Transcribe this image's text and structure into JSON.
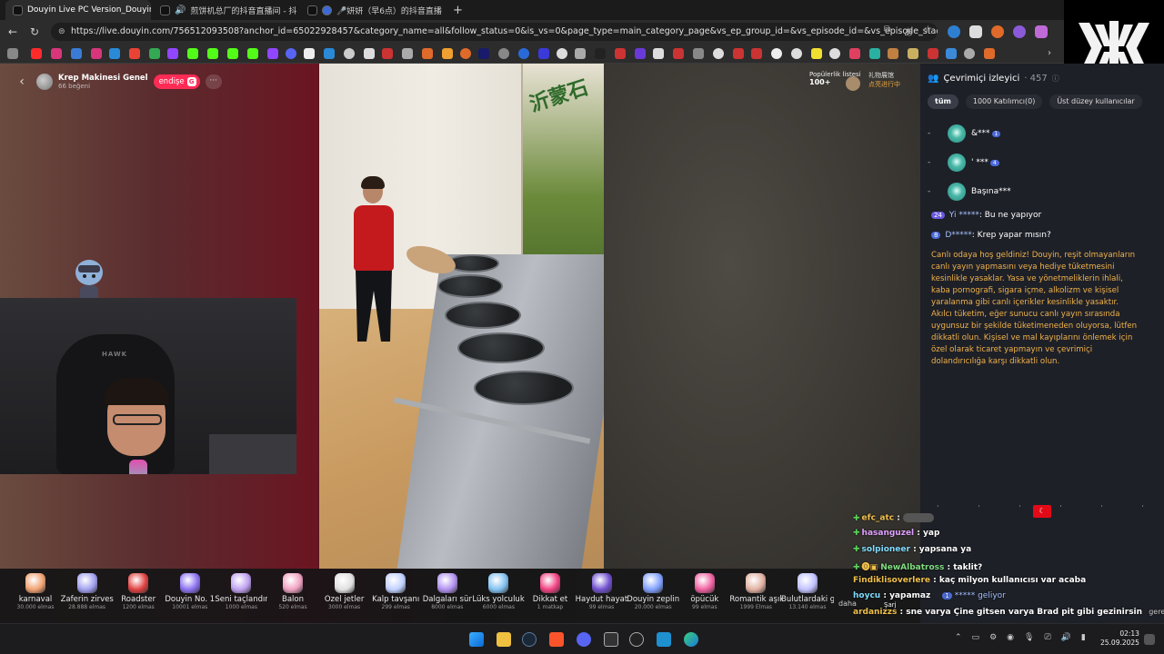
{
  "browser": {
    "tabs": [
      {
        "title": "Douyin Live PC Version_Douyin Li",
        "active": true
      },
      {
        "title": "煎饼机总厂的抖音直播间 - 抖",
        "active": false
      },
      {
        "title": "🎤妍妍（早6点）的抖音直播",
        "active": false
      }
    ],
    "url": "https://live.douyin.com/756512093508?anchor_id=65022928457&category_name=all&follow_status=0&is_vs=0&page_type=main_category_page&vs_ep_group_id=&vs_episode_id=&vs_episode_stage=&vs_season..."
  },
  "stream": {
    "room_name": "Krep Makinesi Genel",
    "likes": "66 beğeni",
    "follow_label": "endişe",
    "follow_badge": "G",
    "more_label": "···",
    "popular_label": "Popülerlik listesi",
    "popular_count": "100+",
    "gift_list_label": "礼物展馆",
    "gift_list_sub": "点亮进行中",
    "poster_text": "沂蒙石",
    "chair_brand": "HAWK"
  },
  "gifts": [
    {
      "name": "karnaval",
      "price": "30.000 elmas",
      "color": "#f0a070"
    },
    {
      "name": "Zaferin zirvesi",
      "price": "28.888 elmas",
      "color": "#a0a0f0"
    },
    {
      "name": "Roadster",
      "price": "1200 elmas",
      "color": "#e04040"
    },
    {
      "name": "Douyin No. 1",
      "price": "10001 elmas",
      "color": "#8a70f0"
    },
    {
      "name": "Seni taçlandır",
      "price": "1000 elmas",
      "color": "#c0a0f0"
    },
    {
      "name": "Balon",
      "price": "520 elmas",
      "color": "#f0a0c0"
    },
    {
      "name": "Özel jetler",
      "price": "3000 elmas",
      "color": "#e0e0e0"
    },
    {
      "name": "Kalp tavşanı",
      "price": "299 elmas",
      "color": "#c0d0ff"
    },
    {
      "name": "Dalgaları sür",
      "price": "8000 elmas",
      "color": "#b090f0"
    },
    {
      "name": "Lüks yolculukla",
      "price": "6000 elmas",
      "color": "#80c0f0"
    },
    {
      "name": "Dikkat et",
      "price": "1 matkap",
      "color": "#f04080"
    },
    {
      "name": "Haydut hayatı",
      "price": "99 elmas",
      "color": "#7050d0"
    },
    {
      "name": "Douyin zeplin",
      "price": "20.000 elmas",
      "color": "#80a0ff"
    },
    {
      "name": "öpücük",
      "price": "99 elmas",
      "color": "#f060a0"
    },
    {
      "name": "Romantik aşıklar",
      "price": "1999 Elmas",
      "color": "#e0b0a0"
    },
    {
      "name": "Bulutlardaki gi",
      "price": "13.140 elmas",
      "color": "#c0c0ff"
    }
  ],
  "gift_more": "daha",
  "chat": {
    "viewers_title": "Çevrimiçi izleyici",
    "viewers_count": "· 457",
    "filters": [
      "tüm",
      "1000 Katılımcı(0)",
      "Üst düzey kullanıcılar"
    ],
    "viewers": [
      {
        "name": "&***",
        "badge": "1"
      },
      {
        "name": "' ***",
        "badge": "4"
      },
      {
        "name": "Başına***",
        "badge": ""
      }
    ],
    "messages": [
      {
        "level": "24",
        "user": "Yi *****",
        "text": ": Bu ne yapıyor"
      },
      {
        "level": "8",
        "user": "D*****",
        "text": ": Krep yapar mısın?"
      }
    ],
    "notice": "Canlı odaya hoş geldiniz! Douyin, reşit olmayanların canlı yayın yapmasını veya hediye tüketmesini kesinlikle yasaklar. Yasa ve yönetmeliklerin ihlali, kaba pornografi, sigara içme, alkolizm ve kişisel yaralanma gibi canlı içerikler kesinlikle yasaktır. Akılcı tüketim, eğer sunucu canlı yayın sırasında uygunsuz bir şekilde tüketimeneden oluyorsa, lütfen dikkatli olun. Kişisel ve mal kayıplarını önlemek için özel olarak ticaret yapmayın ve çevrimiçi dolandırıcılığa karşı dikkatli olun."
  },
  "overlay_chat": [
    {
      "user": "efc_atc",
      "text": " :"
    },
    {
      "user": "hasanguzel",
      "text": " : yap"
    },
    {
      "user": "solpioneer",
      "text": " : yapsana ya"
    },
    {
      "user": "NewAlbatross",
      "text": " : taklit?"
    },
    {
      "user": "Findiklisoverlere",
      "text": " : kaç milyon kullanıcısı var acaba"
    },
    {
      "user": "hoycu",
      "text": " : yapamaz"
    },
    {
      "user": "ardanizzs",
      "text": " : sne varya Çine gitsen varya Brad pit gibi gezinirsin"
    }
  ],
  "overlay_extra": {
    "geliyor_user": "***** geliyor",
    "sarj": "Şarj",
    "gerekir": "gerekir"
  },
  "taskbar": {
    "time": "02:13",
    "date": "25.09.2025"
  }
}
